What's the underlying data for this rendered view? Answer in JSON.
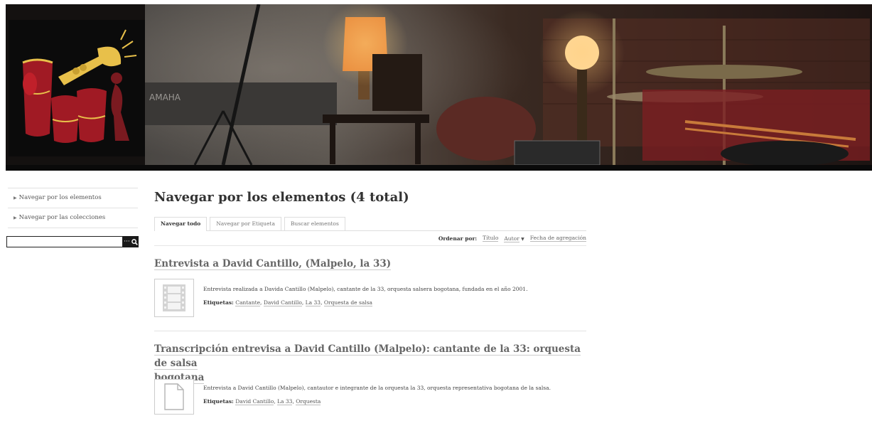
{
  "sidebar": {
    "items": [
      {
        "label": "Navegar por los elementos"
      },
      {
        "label": "Navegar por las colecciones"
      }
    ],
    "search": {
      "value": "",
      "button_dots": "···"
    }
  },
  "main": {
    "title": "Navegar por los elementos (4 total)",
    "tabs": [
      {
        "label": "Navegar todo",
        "active": true
      },
      {
        "label": "Navegar por Etiqueta",
        "active": false
      },
      {
        "label": "Buscar elementos",
        "active": false
      }
    ],
    "sort": {
      "label": "Ordenar por:",
      "options": [
        "Título",
        "Autor",
        "Fecha de agregación"
      ]
    },
    "items": [
      {
        "title": "Entrevista a David Cantillo, (Malpelo, la 33)",
        "thumb_icon": "film-icon",
        "description": "Entrevista realizada a Davida Cantillo (Malpelo), cantante de la 33, orquesta salsera bogotana, fundada en el año 2001.",
        "tags_label": "Etiquetas:",
        "tags": [
          "Cantante",
          "David Cantillo",
          "La 33",
          "Orquesta de salsa"
        ]
      },
      {
        "title_line1": "Transcripción entrevisa a David Cantillo (Malpelo): cantante de la 33: orquesta de salsa",
        "title_line2": "bogotana",
        "thumb_icon": "document-icon",
        "description": "Entrevista a David Cantillo (Malpelo), cantautor e integrante de la orquesta la 33, orquesta representativa bogotana de la salsa.",
        "tags_label": "Etiquetas:",
        "tags": [
          "David Cantillo",
          "La 33",
          "Orquesta"
        ]
      }
    ]
  }
}
